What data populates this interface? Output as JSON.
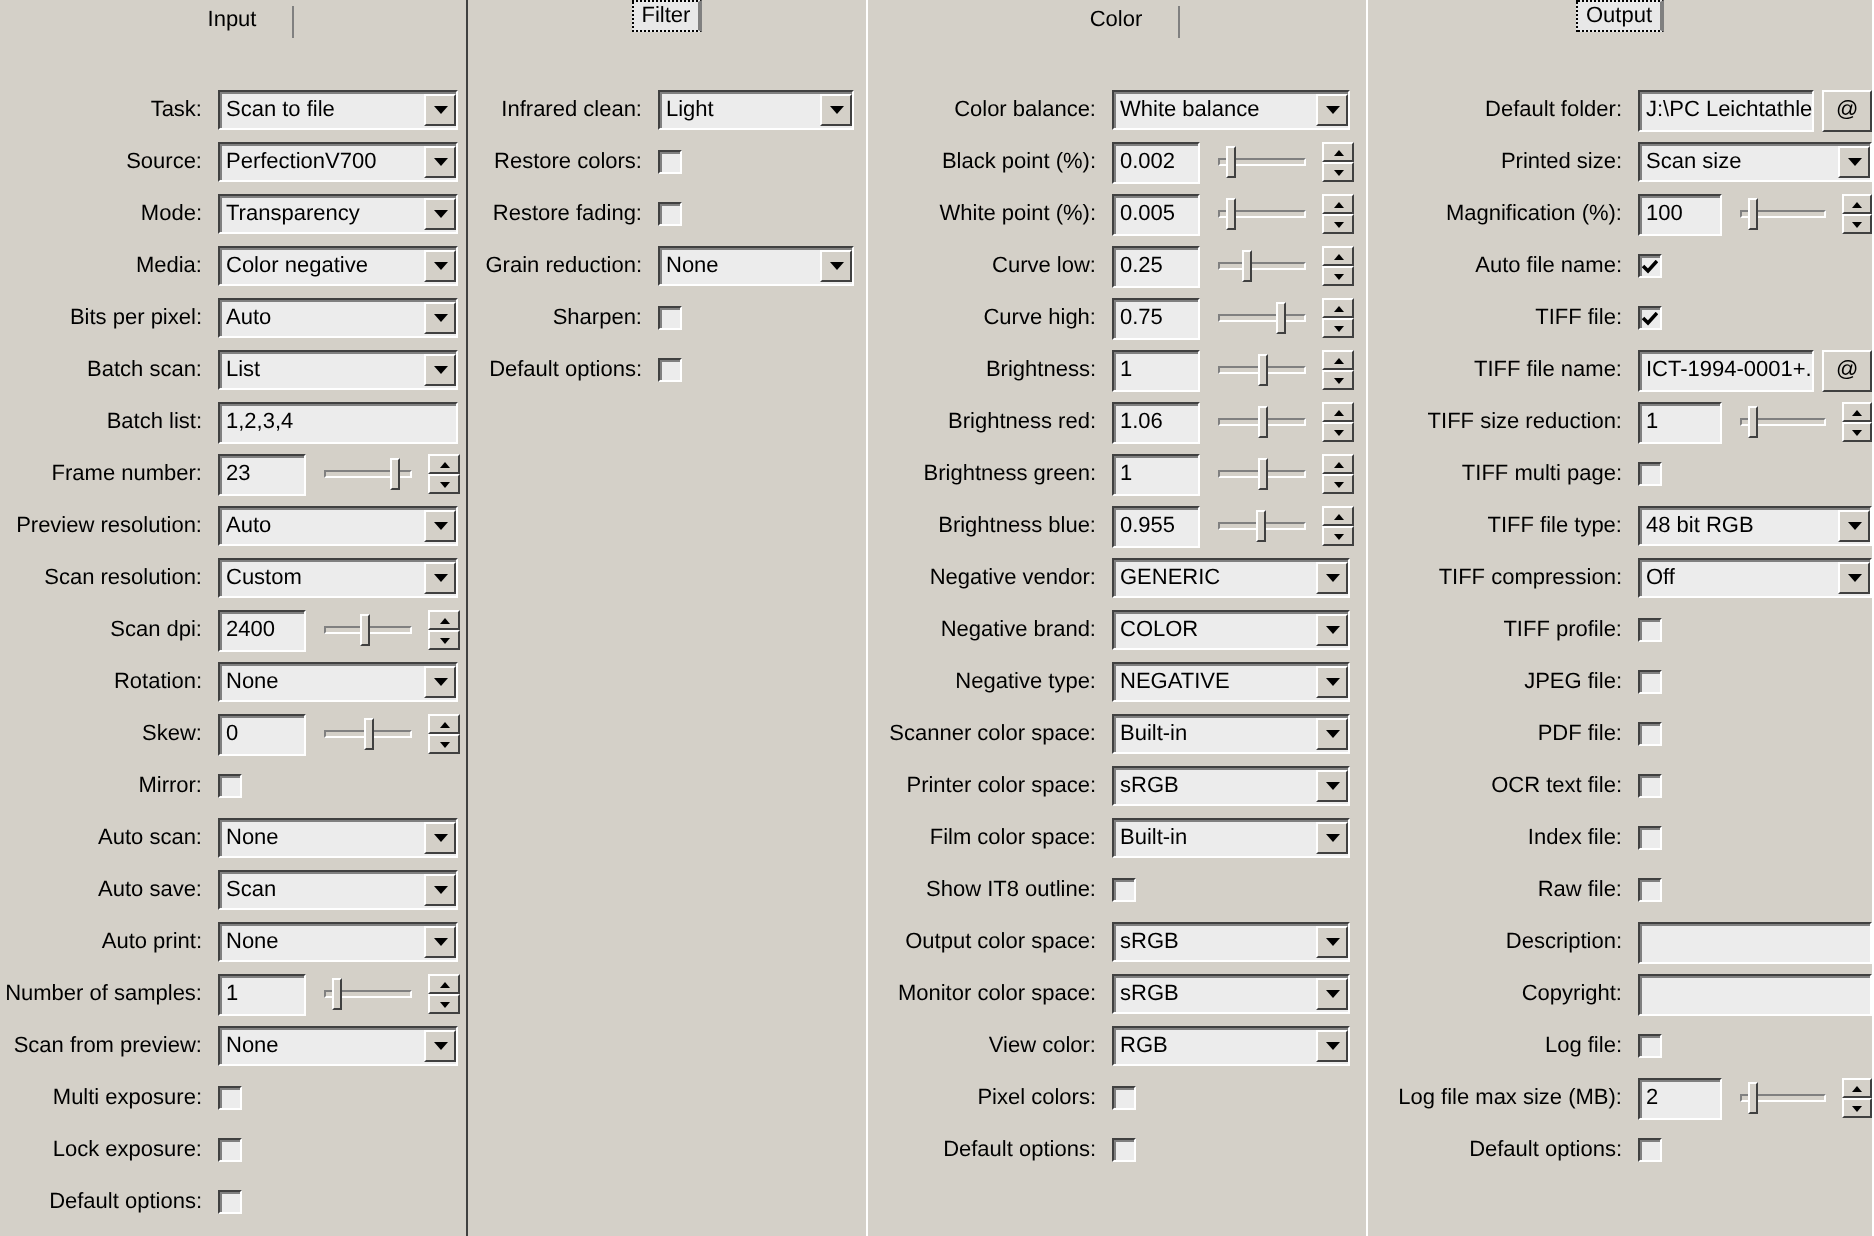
{
  "panels": [
    {
      "tab": {
        "label": "Input",
        "focused": false
      },
      "rows": [
        {
          "kind": "select",
          "label": "Task:",
          "value": "Scan to file"
        },
        {
          "kind": "select",
          "label": "Source:",
          "value": "PerfectionV700"
        },
        {
          "kind": "select",
          "label": "Mode:",
          "value": "Transparency"
        },
        {
          "kind": "select",
          "label": "Media:",
          "value": "Color negative"
        },
        {
          "kind": "select",
          "label": "Bits per pixel:",
          "value": "Auto"
        },
        {
          "kind": "select",
          "label": "Batch scan:",
          "value": "List"
        },
        {
          "kind": "text",
          "label": "Batch list:",
          "value": "1,2,3,4"
        },
        {
          "kind": "slider",
          "label": "Frame number:",
          "value": "23",
          "level": 0.85
        },
        {
          "kind": "select",
          "label": "Preview resolution:",
          "value": "Auto"
        },
        {
          "kind": "select",
          "label": "Scan resolution:",
          "value": "Custom"
        },
        {
          "kind": "slider",
          "label": "Scan dpi:",
          "value": "2400",
          "level": 0.45
        },
        {
          "kind": "select",
          "label": "Rotation:",
          "value": "None"
        },
        {
          "kind": "slider",
          "label": "Skew:",
          "value": "0",
          "level": 0.5
        },
        {
          "kind": "checkbox",
          "label": "Mirror:",
          "checked": false
        },
        {
          "kind": "select",
          "label": "Auto scan:",
          "value": "None"
        },
        {
          "kind": "select",
          "label": "Auto save:",
          "value": "Scan"
        },
        {
          "kind": "select",
          "label": "Auto print:",
          "value": "None"
        },
        {
          "kind": "slider",
          "label": "Number of samples:",
          "value": "1",
          "level": 0.1
        },
        {
          "kind": "select",
          "label": "Scan from preview:",
          "value": "None"
        },
        {
          "kind": "checkbox",
          "label": "Multi exposure:",
          "checked": false
        },
        {
          "kind": "checkbox",
          "label": "Lock exposure:",
          "checked": false
        },
        {
          "kind": "checkbox",
          "label": "Default options:",
          "checked": false
        }
      ]
    },
    {
      "tab": {
        "label": "Filter",
        "focused": true
      },
      "rows": [
        {
          "kind": "select",
          "label": "Infrared clean:",
          "value": "Light"
        },
        {
          "kind": "checkbox",
          "label": "Restore colors:",
          "checked": false
        },
        {
          "kind": "checkbox",
          "label": "Restore fading:",
          "checked": false
        },
        {
          "kind": "select",
          "label": "Grain reduction:",
          "value": "None"
        },
        {
          "kind": "checkbox",
          "label": "Sharpen:",
          "checked": false
        },
        {
          "kind": "checkbox",
          "label": "Default options:",
          "checked": false
        }
      ]
    },
    {
      "tab": {
        "label": "Color",
        "focused": false
      },
      "rows": [
        {
          "kind": "select",
          "label": "Color balance:",
          "value": "White balance"
        },
        {
          "kind": "slider",
          "label": "Black point (%):",
          "value": "0.002",
          "level": 0.1
        },
        {
          "kind": "slider",
          "label": "White point (%):",
          "value": "0.005",
          "level": 0.1
        },
        {
          "kind": "slider",
          "label": "Curve low:",
          "value": "0.25",
          "level": 0.3
        },
        {
          "kind": "slider",
          "label": "Curve high:",
          "value": "0.75",
          "level": 0.75
        },
        {
          "kind": "slider",
          "label": "Brightness:",
          "value": "1",
          "level": 0.5
        },
        {
          "kind": "slider",
          "label": "Brightness red:",
          "value": "1.06",
          "level": 0.52
        },
        {
          "kind": "slider",
          "label": "Brightness green:",
          "value": "1",
          "level": 0.5
        },
        {
          "kind": "slider",
          "label": "Brightness blue:",
          "value": "0.955",
          "level": 0.48
        },
        {
          "kind": "select",
          "label": "Negative vendor:",
          "value": "GENERIC"
        },
        {
          "kind": "select",
          "label": "Negative brand:",
          "value": "COLOR"
        },
        {
          "kind": "select",
          "label": "Negative type:",
          "value": "NEGATIVE"
        },
        {
          "kind": "select",
          "label": "Scanner color space:",
          "value": "Built-in"
        },
        {
          "kind": "select",
          "label": "Printer color space:",
          "value": "sRGB"
        },
        {
          "kind": "select",
          "label": "Film color space:",
          "value": "Built-in"
        },
        {
          "kind": "checkbox",
          "label": "Show IT8 outline:",
          "checked": false
        },
        {
          "kind": "select",
          "label": "Output color space:",
          "value": "sRGB"
        },
        {
          "kind": "select",
          "label": "Monitor color space:",
          "value": "sRGB"
        },
        {
          "kind": "select",
          "label": "View color:",
          "value": "RGB"
        },
        {
          "kind": "checkbox",
          "label": "Pixel colors:",
          "checked": false
        },
        {
          "kind": "checkbox",
          "label": "Default options:",
          "checked": false
        }
      ]
    },
    {
      "tab": {
        "label": "Output",
        "focused": true
      },
      "rows": [
        {
          "kind": "browse",
          "label": "Default folder:",
          "value": "J:\\PC Leichtathle",
          "button": "@"
        },
        {
          "kind": "select",
          "label": "Printed size:",
          "value": "Scan size"
        },
        {
          "kind": "slider",
          "label": "Magnification (%):",
          "value": "100",
          "level": 0.1
        },
        {
          "kind": "checkbox",
          "label": "Auto file name:",
          "checked": true
        },
        {
          "kind": "checkbox",
          "label": "TIFF file:",
          "checked": true
        },
        {
          "kind": "browse",
          "label": "TIFF file name:",
          "value": "ICT-1994-0001+.",
          "button": "@"
        },
        {
          "kind": "slider",
          "label": "TIFF size reduction:",
          "value": "1",
          "level": 0.1
        },
        {
          "kind": "checkbox",
          "label": "TIFF multi page:",
          "checked": false
        },
        {
          "kind": "select",
          "label": "TIFF file type:",
          "value": "48 bit RGB"
        },
        {
          "kind": "select",
          "label": "TIFF compression:",
          "value": "Off"
        },
        {
          "kind": "checkbox",
          "label": "TIFF profile:",
          "checked": false
        },
        {
          "kind": "checkbox",
          "label": "JPEG file:",
          "checked": false
        },
        {
          "kind": "checkbox",
          "label": "PDF file:",
          "checked": false
        },
        {
          "kind": "checkbox",
          "label": "OCR text file:",
          "checked": false
        },
        {
          "kind": "checkbox",
          "label": "Index file:",
          "checked": false
        },
        {
          "kind": "checkbox",
          "label": "Raw file:",
          "checked": false
        },
        {
          "kind": "text",
          "label": "Description:"
        },
        {
          "kind": "text",
          "label": "Copyright:"
        },
        {
          "kind": "checkbox",
          "label": "Log file:",
          "checked": false
        },
        {
          "kind": "slider",
          "label": "Log file max size (MB):",
          "value": "2",
          "level": 0.1
        },
        {
          "kind": "checkbox",
          "label": "Default options:",
          "checked": false
        }
      ]
    }
  ]
}
